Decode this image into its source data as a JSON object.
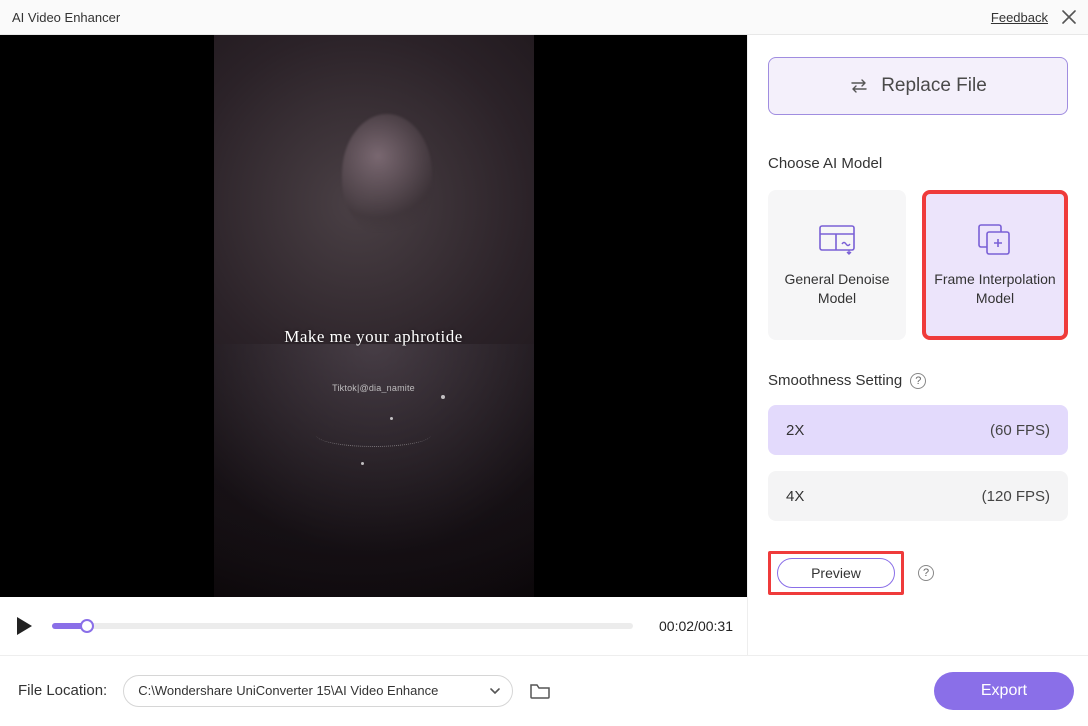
{
  "titlebar": {
    "title": "AI Video Enhancer",
    "feedback": "Feedback"
  },
  "video": {
    "caption": "Make me your aphrotide",
    "handle": "Tiktok|@dia_namite",
    "time_current": "00:02",
    "time_total": "00:31"
  },
  "side": {
    "replace_label": "Replace File",
    "choose_model": "Choose AI Model",
    "models": [
      {
        "label": "General Denoise Model"
      },
      {
        "label": "Frame Interpolation Model"
      }
    ],
    "smooth_label": "Smoothness Setting",
    "smooth_options": [
      {
        "factor": "2X",
        "fps": "(60 FPS)",
        "selected": true
      },
      {
        "factor": "4X",
        "fps": "(120 FPS)",
        "selected": false
      }
    ],
    "preview_label": "Preview"
  },
  "footer": {
    "label": "File Location:",
    "path": "C:\\Wondershare UniConverter 15\\AI Video Enhance",
    "export": "Export"
  }
}
